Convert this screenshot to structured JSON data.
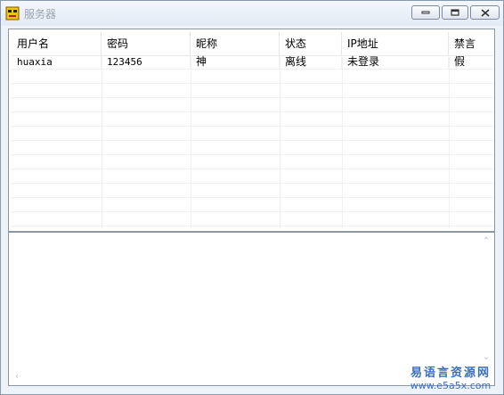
{
  "window": {
    "title": "服务器"
  },
  "table": {
    "columns": [
      "用户名",
      "密码",
      "昵称",
      "状态",
      "IP地址",
      "禁言"
    ],
    "rows": [
      [
        "huaxia",
        "123456",
        "神",
        "离线",
        "未登录",
        "假"
      ]
    ]
  },
  "textarea": {
    "value": ""
  },
  "watermark": {
    "cn": "易语言资源网",
    "url": "www.e5a5x.com"
  }
}
